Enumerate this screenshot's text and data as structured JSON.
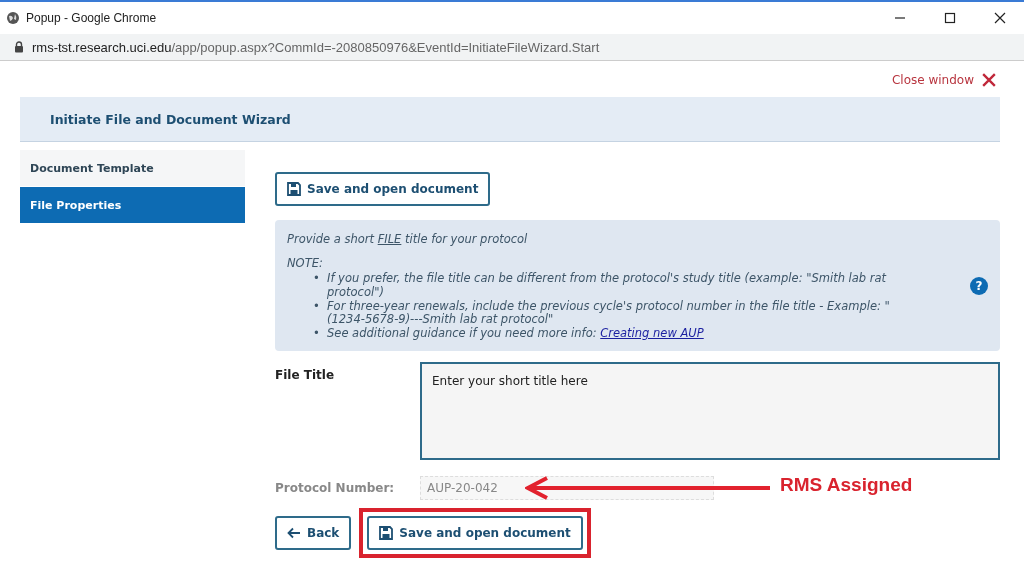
{
  "window": {
    "title": "Popup - Google Chrome",
    "url_host": "rms-tst.research.uci.edu",
    "url_path": "/app/popup.aspx?CommId=-2080850976&EventId=InitiateFileWizard.Start"
  },
  "close_link": "Close window",
  "wizard_title": "Initiate File and Document Wizard",
  "sidebar": {
    "items": [
      {
        "label": "Document Template",
        "selected": false
      },
      {
        "label": "File Properties",
        "selected": true
      }
    ]
  },
  "top_button": "Save and open document",
  "note": {
    "prompt_before": "Provide a short ",
    "prompt_underlined": "FILE",
    "prompt_after": " title for your protocol",
    "heading": "NOTE:",
    "bullets": [
      {
        "marker": "•",
        "text": "If you prefer, the file title can be different from the protocol's study title (example: \"Smith lab rat protocol\")"
      },
      {
        "marker": "•",
        "text": "For three-year renewals, include the previous cycle's protocol number in the file title - Example: \"(1234-5678-9)---Smith lab rat protocol\""
      },
      {
        "marker": "•",
        "text": "See additional guidance if you need more info: ",
        "link": "Creating new AUP"
      }
    ],
    "help": "?"
  },
  "file_title": {
    "label": "File Title",
    "value": "Enter your short title here"
  },
  "protocol_number": {
    "label": "Protocol Number:",
    "value": "AUP-20-042",
    "disabled": true
  },
  "buttons": [
    {
      "label": "Back",
      "kind": "back"
    },
    {
      "label": "Save and open document",
      "kind": "save"
    }
  ],
  "annotation": {
    "label": "RMS Assigned"
  }
}
